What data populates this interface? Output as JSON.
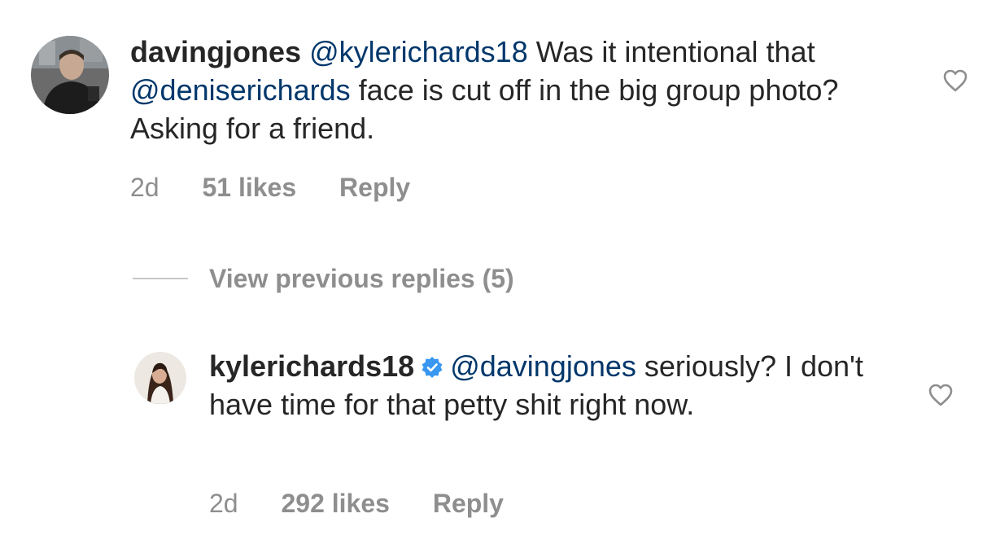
{
  "comments": [
    {
      "username": "davingjones",
      "mention": "@kylerichards18",
      "text_part1": " Was it intentional that ",
      "inline_mention": "@deniserichards",
      "text_part2": " face is cut off in the big group photo? Asking for a friend.",
      "time": "2d",
      "likes": "51 likes",
      "reply_label": "Reply"
    },
    {
      "username": "kylerichards18",
      "verified": true,
      "mention": "@davingjones",
      "text": " seriously? I don't have time for that petty shit right now.",
      "time": "2d",
      "likes": "292 likes",
      "reply_label": "Reply"
    }
  ],
  "view_replies_label": "View previous replies (5)",
  "colors": {
    "text": "#262626",
    "mention": "#00376b",
    "meta": "#8e8e8e",
    "verified": "#3897f0"
  }
}
